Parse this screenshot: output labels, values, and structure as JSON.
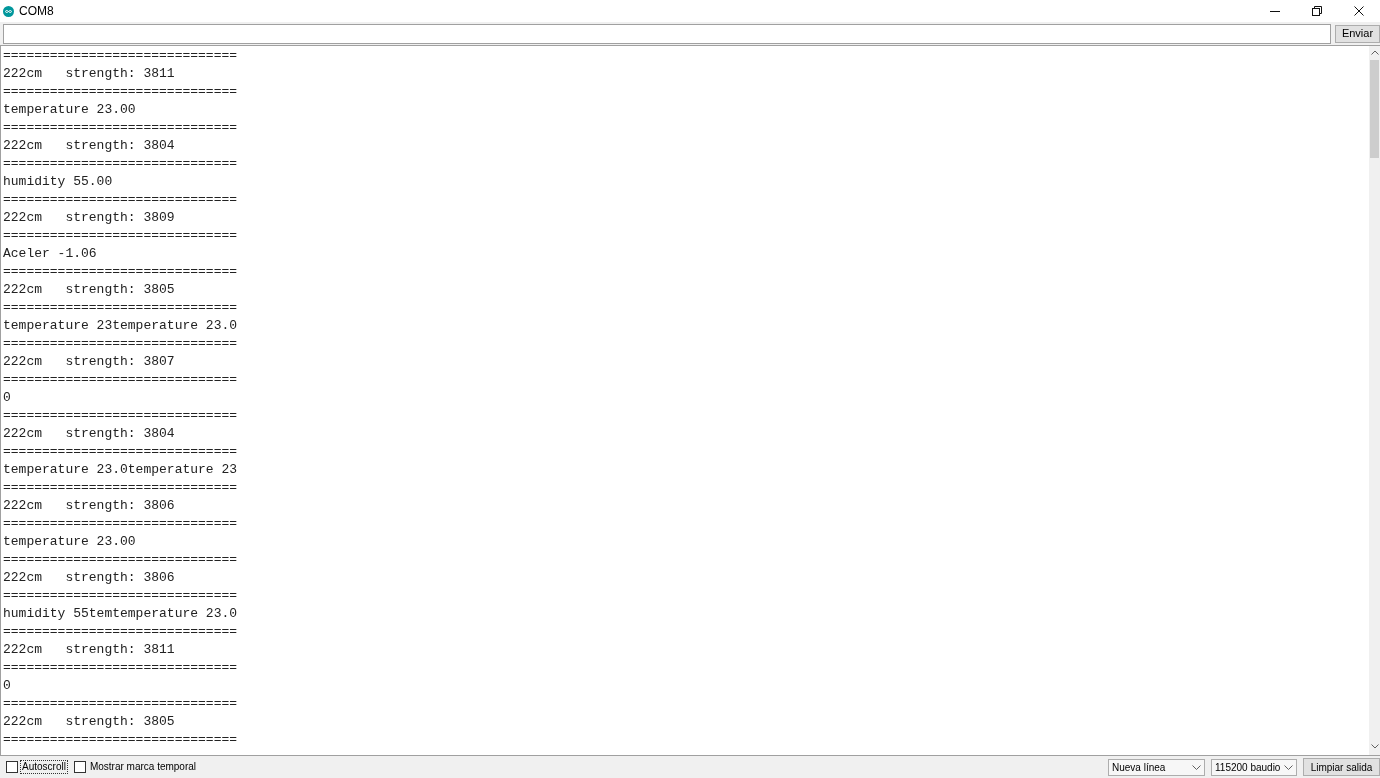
{
  "window": {
    "title": "COM8"
  },
  "send_bar": {
    "button": "Enviar"
  },
  "output": {
    "lines": [
      "==============================",
      "222cm   strength: 3811",
      "==============================",
      "temperature 23.00",
      "==============================",
      "222cm   strength: 3804",
      "==============================",
      "humidity 55.00",
      "==============================",
      "222cm   strength: 3809",
      "==============================",
      "Aceler -1.06",
      "==============================",
      "222cm   strength: 3805",
      "==============================",
      "temperature 23temperature 23.0",
      "==============================",
      "222cm   strength: 3807",
      "==============================",
      "0",
      "==============================",
      "222cm   strength: 3804",
      "==============================",
      "temperature 23.0temperature 23",
      "==============================",
      "222cm   strength: 3806",
      "==============================",
      "temperature 23.00",
      "==============================",
      "222cm   strength: 3806",
      "==============================",
      "humidity 55temtemperature 23.0",
      "==============================",
      "222cm   strength: 3811",
      "==============================",
      "0",
      "==============================",
      "222cm   strength: 3805",
      "=============================="
    ]
  },
  "footer": {
    "checkboxes": [
      {
        "label": "Autoscroll",
        "checked": false,
        "focused": true
      },
      {
        "label": "Mostrar marca temporal",
        "checked": false,
        "focused": false
      }
    ],
    "selects": [
      {
        "value": "Nueva línea"
      },
      {
        "value": "115200 baudio"
      }
    ],
    "button": "Limpiar salida"
  }
}
